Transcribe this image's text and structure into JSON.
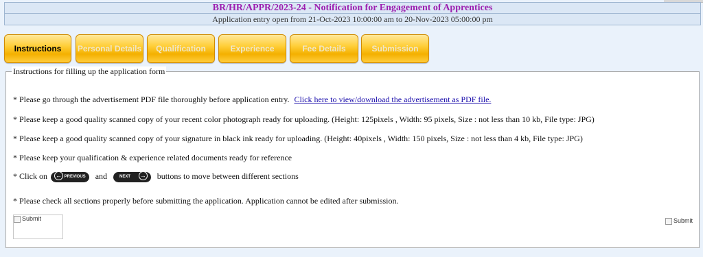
{
  "header": {
    "title": "BR/HR/APPR/2023-24 - Notification for Engagement of Apprentices",
    "subtitle": "Application entry open from 21-Oct-2023 10:00:00 am to 20-Nov-2023 05:00:00 pm"
  },
  "tabs": [
    {
      "label": "Instructions",
      "active": true
    },
    {
      "label": "Personal Details",
      "active": false
    },
    {
      "label": "Qualification",
      "active": false
    },
    {
      "label": "Experience",
      "active": false
    },
    {
      "label": "Fee Details",
      "active": false
    },
    {
      "label": "Submission",
      "active": false
    }
  ],
  "panel": {
    "legend": "Instructions for filling up the application form",
    "line1": "* Please go through the advertisement PDF file thoroughly before application entry.",
    "line1_link": "Click here to view/download the advertisement as PDF file.",
    "line2": "* Please keep a good quality scanned copy of your recent color photograph ready for uploading. (Height: 125pixels , Width: 95 pixels, Size : not less than 10 kb, File type: JPG)",
    "line3": "* Please keep a good quality scanned copy of your signature in black ink ready for uploading. (Height: 40pixels , Width: 150 pixels, Size : not less than 4 kb, File type: JPG)",
    "line4": "* Please keep your qualification & experience related documents ready for reference",
    "line5_prefix": "* Click on",
    "line5_and": "and",
    "line5_suffix": "buttons to move between different sections",
    "previous_label": "PREVIOUS",
    "next_label": "NEXT",
    "line6": "* Please check all sections properly before submitting the application. Application cannot be edited after submission.",
    "submit_left": "Submit",
    "submit_right": "Submit"
  }
}
